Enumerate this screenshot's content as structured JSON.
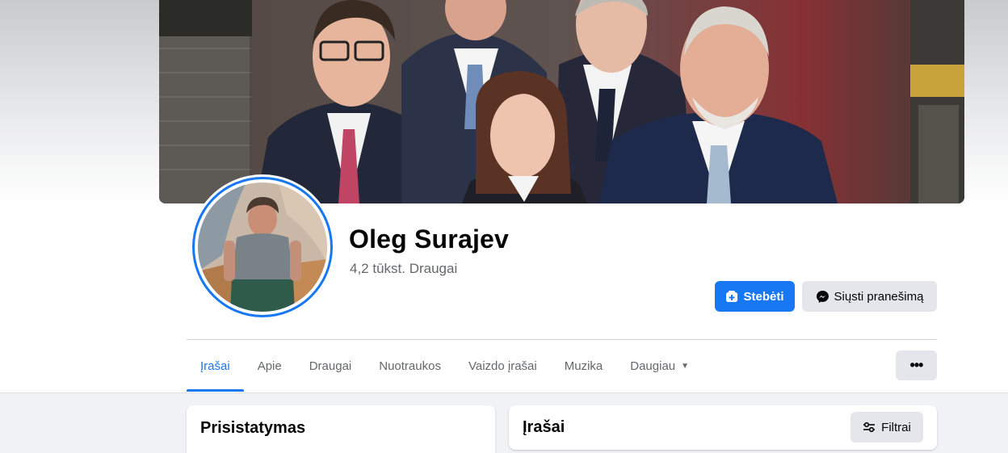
{
  "profile": {
    "name": "Oleg Surajev",
    "friends": "4,2 tūkst. Draugai"
  },
  "actions": {
    "follow_label": "Stebėti",
    "message_label": "Siųsti pranešimą"
  },
  "tabs": [
    {
      "label": "Įrašai",
      "active": true
    },
    {
      "label": "Apie"
    },
    {
      "label": "Draugai"
    },
    {
      "label": "Nuotraukos"
    },
    {
      "label": "Vaizdo įrašai"
    },
    {
      "label": "Muzika"
    },
    {
      "label": "Daugiau"
    }
  ],
  "more_menu": {
    "icon": "ellipsis-icon"
  },
  "intro_card": {
    "title": "Prisistatymas"
  },
  "posts_card": {
    "title": "Įrašai",
    "filter_label": "Filtrai"
  },
  "colors": {
    "accent": "#1877f2",
    "secondary_button": "#e4e6eb",
    "background": "#f0f2f5"
  }
}
